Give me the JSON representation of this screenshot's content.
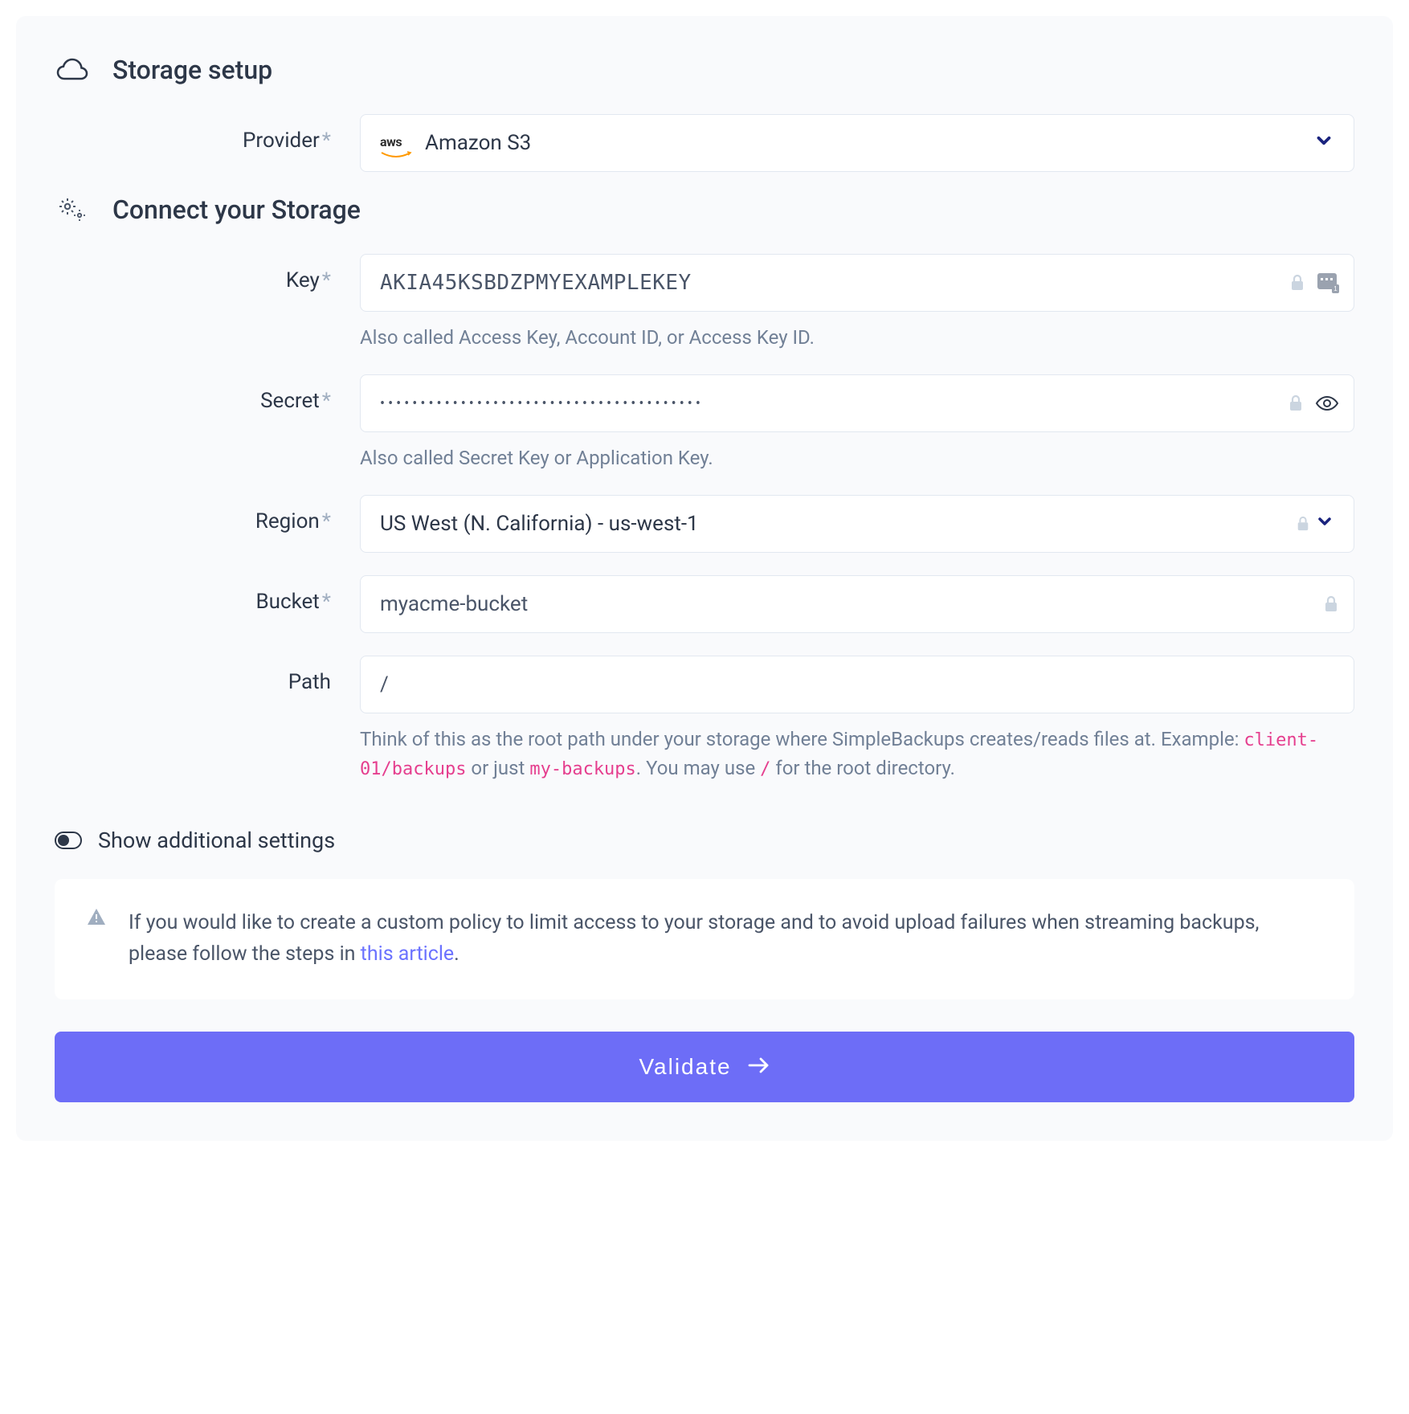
{
  "sections": {
    "storage_setup": "Storage setup",
    "connect": "Connect your Storage"
  },
  "provider": {
    "label": "Provider",
    "value": "Amazon S3",
    "badge": "aws"
  },
  "fields": {
    "key": {
      "label": "Key",
      "value": "AKIA45KSBDZPMYEXAMPLEKEY",
      "helper": "Also called Access Key, Account ID, or Access Key ID."
    },
    "secret": {
      "label": "Secret",
      "value": "••••••••••••••••••••••••••••••••••••••••",
      "helper": "Also called Secret Key or Application Key."
    },
    "region": {
      "label": "Region",
      "value": "US West (N. California) - us-west-1"
    },
    "bucket": {
      "label": "Bucket",
      "value": "myacme-bucket"
    },
    "path": {
      "label": "Path",
      "value": "/",
      "helper_prefix": "Think of this as the root path under your storage where SimpleBackups creates/reads files at. Example: ",
      "helper_code1": "client-01/backups",
      "helper_mid": " or just ",
      "helper_code2": "my-backups",
      "helper_mid2": ". You may use ",
      "helper_code3": "/",
      "helper_suffix": " for the root directory."
    }
  },
  "toggle": {
    "label": "Show additional settings"
  },
  "notice": {
    "text_before": "If you would like to create a custom policy to limit access to your storage and to avoid upload failures when streaming backups, please follow the steps in ",
    "link_text": "this article",
    "text_after": "."
  },
  "actions": {
    "validate": "Validate"
  },
  "required_mark": "*"
}
